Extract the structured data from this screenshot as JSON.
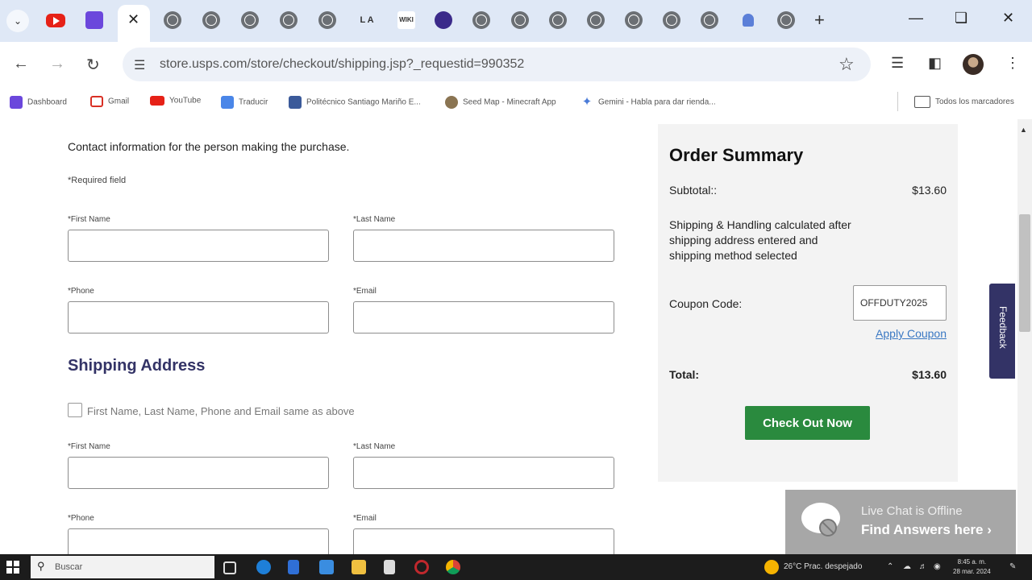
{
  "browser": {
    "address": "store.usps.com/store/checkout/shipping.jsp?_requestid=990352",
    "tab_icons": [
      "youtube-icon",
      "twitch-icon",
      "close-icon",
      "globe-icon",
      "globe-icon",
      "globe-icon",
      "globe-icon",
      "globe-icon",
      "la-icon",
      "wiki-icon",
      "purple-icon",
      "globe-icon",
      "globe-icon",
      "globe-icon",
      "globe-icon",
      "globe-icon",
      "globe-icon",
      "globe-icon",
      "bell-icon",
      "globe-icon"
    ],
    "tab_la_text": "L A",
    "tab_wiki_text": "WIKI",
    "new_tab": "+"
  },
  "bookmarks": {
    "items": [
      "Dashboard",
      "Gmail",
      "YouTube",
      "Traducir",
      "Politécnico Santiago Mariño E...",
      "Seed Map - Minecraft App",
      "Gemini - Habla para dar rienda..."
    ],
    "all_bookmarks": "Todos los marcadores"
  },
  "form": {
    "contact_intro": "Contact information for the person making the purchase.",
    "required_note": "*Required field",
    "first_name_label": "*First Name",
    "last_name_label": "*Last Name",
    "phone_label": "*Phone",
    "email_label": "*Email",
    "shipping_heading": "Shipping Address",
    "same_as_above": "First Name, Last Name, Phone and Email same as above"
  },
  "summary": {
    "title": "Order Summary",
    "subtotal_label": "Subtotal::",
    "subtotal_value": "$13.60",
    "shipping_note": "Shipping & Handling calculated after shipping address entered and shipping method selected",
    "coupon_label": "Coupon Code:",
    "coupon_value": "OFFDUTY2025",
    "apply_link": "Apply Coupon",
    "total_label": "Total:",
    "total_value": "$13.60",
    "checkout_button": "Check Out Now"
  },
  "feedback": "Feedback",
  "live_chat": {
    "status": "Live Chat is Offline",
    "cta": "Find Answers here ›"
  },
  "taskbar": {
    "search_placeholder": "Buscar",
    "weather": "26°C  Prac. despejado",
    "time": "8:45 a. m.",
    "date": "28 mar. 2024"
  },
  "colors": {
    "tabstrip": "#dfe8f6",
    "heading": "#333366",
    "checkout_green": "#2a8a3e",
    "link_blue": "#3a78c3",
    "feedback_bg": "#333366"
  }
}
